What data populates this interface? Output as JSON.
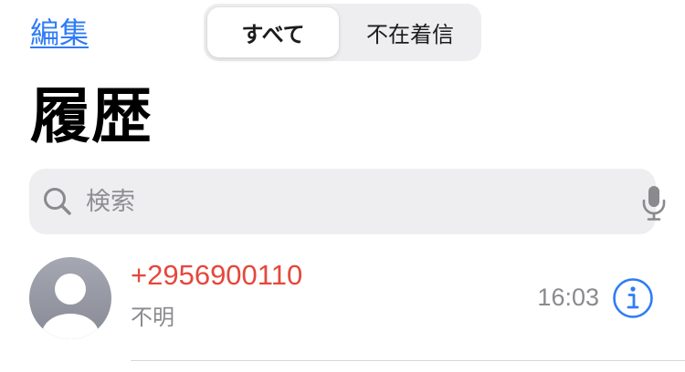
{
  "header": {
    "edit_label": "編集"
  },
  "filter": {
    "all_label": "すべて",
    "missed_label": "不在着信",
    "selected": "すべて"
  },
  "title": "履歴",
  "search": {
    "placeholder": "検索",
    "value": ""
  },
  "calls": [
    {
      "number": "+2956900110",
      "type": "不明",
      "time": "16:03",
      "missed": true
    }
  ],
  "icons": {
    "search": "magnifying-glass",
    "mic": "microphone",
    "avatar": "person-placeholder",
    "info": "info-circle"
  },
  "colors": {
    "accent": "#2f7cf6",
    "missed": "#e5473d",
    "secondary_text": "#8a8a8e",
    "field_bg": "#eeeef0"
  }
}
